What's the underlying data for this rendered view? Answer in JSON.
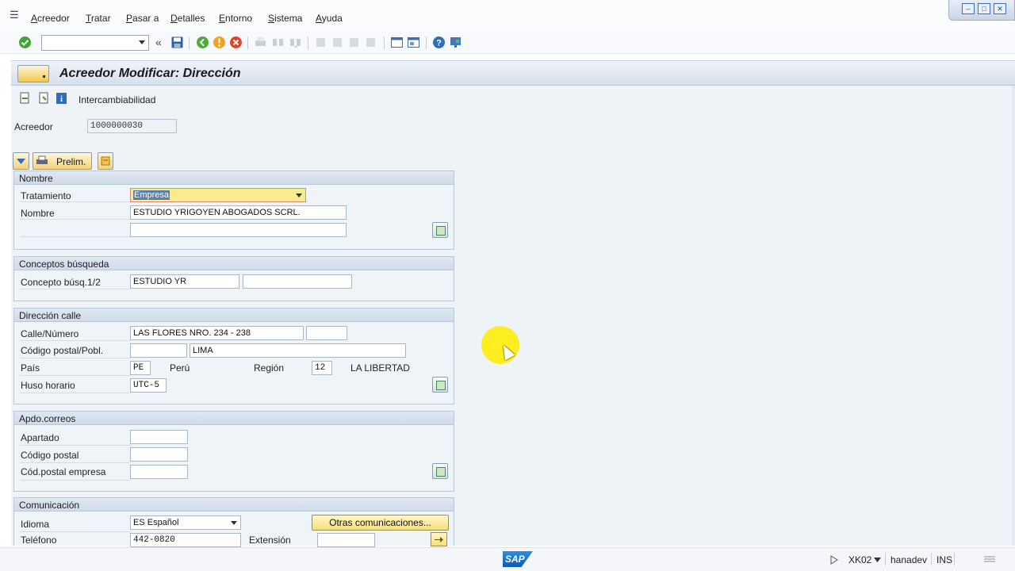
{
  "menu": {
    "items": [
      "Acreedor",
      "Tratar",
      "Pasar a",
      "Detalles",
      "Entorno",
      "Sistema",
      "Ayuda"
    ]
  },
  "title": {
    "text": "Acreedor Modificar: Dirección"
  },
  "appbar": {
    "intercambiabilidad": "Intercambiabilidad"
  },
  "header": {
    "acreedor_label": "Acreedor",
    "acreedor_value": "1000000030"
  },
  "buttons": {
    "prelim": "Prelim.",
    "otras_comunicaciones": "Otras comunicaciones..."
  },
  "nombre": {
    "heading": "Nombre",
    "tratamiento_label": "Tratamiento",
    "tratamiento_value": "Empresa",
    "nombre_label": "Nombre",
    "nombre_value": "ESTUDIO YRIGOYEN ABOGADOS  SCRL.",
    "nombre2_value": ""
  },
  "conceptos": {
    "heading": "Conceptos búsqueda",
    "label": "Concepto búsq.1/2",
    "value1": "ESTUDIO YR",
    "value2": ""
  },
  "direccion": {
    "heading": "Dirección calle",
    "calle_label": "Calle/Número",
    "calle_value": "LAS FLORES NRO. 234 - 238",
    "numero_value": "",
    "cp_label": "Código postal/Pobl.",
    "cp_value": "",
    "poblacion_value": "LIMA",
    "pais_label": "País",
    "pais_value": "PE",
    "pais_name": "Perú",
    "region_label": "Región",
    "region_value": "12",
    "region_name": "LA LIBERTAD",
    "huso_label": "Huso horario",
    "huso_value": "UTC-5"
  },
  "apdo": {
    "heading": "Apdo.correos",
    "apartado_label": "Apartado",
    "cp_label": "Código postal",
    "cp_empresa_label": "Cód.postal empresa"
  },
  "comunicacion": {
    "heading": "Comunicación",
    "idioma_label": "Idioma",
    "idioma_value": "ES Español",
    "telefono_label": "Teléfono",
    "telefono_value": "442-0820",
    "extension_label": "Extensión",
    "extension_value": ""
  },
  "status": {
    "transaction": "XK02",
    "server": "hanadev",
    "mode": "INS",
    "logo": "SAP"
  }
}
